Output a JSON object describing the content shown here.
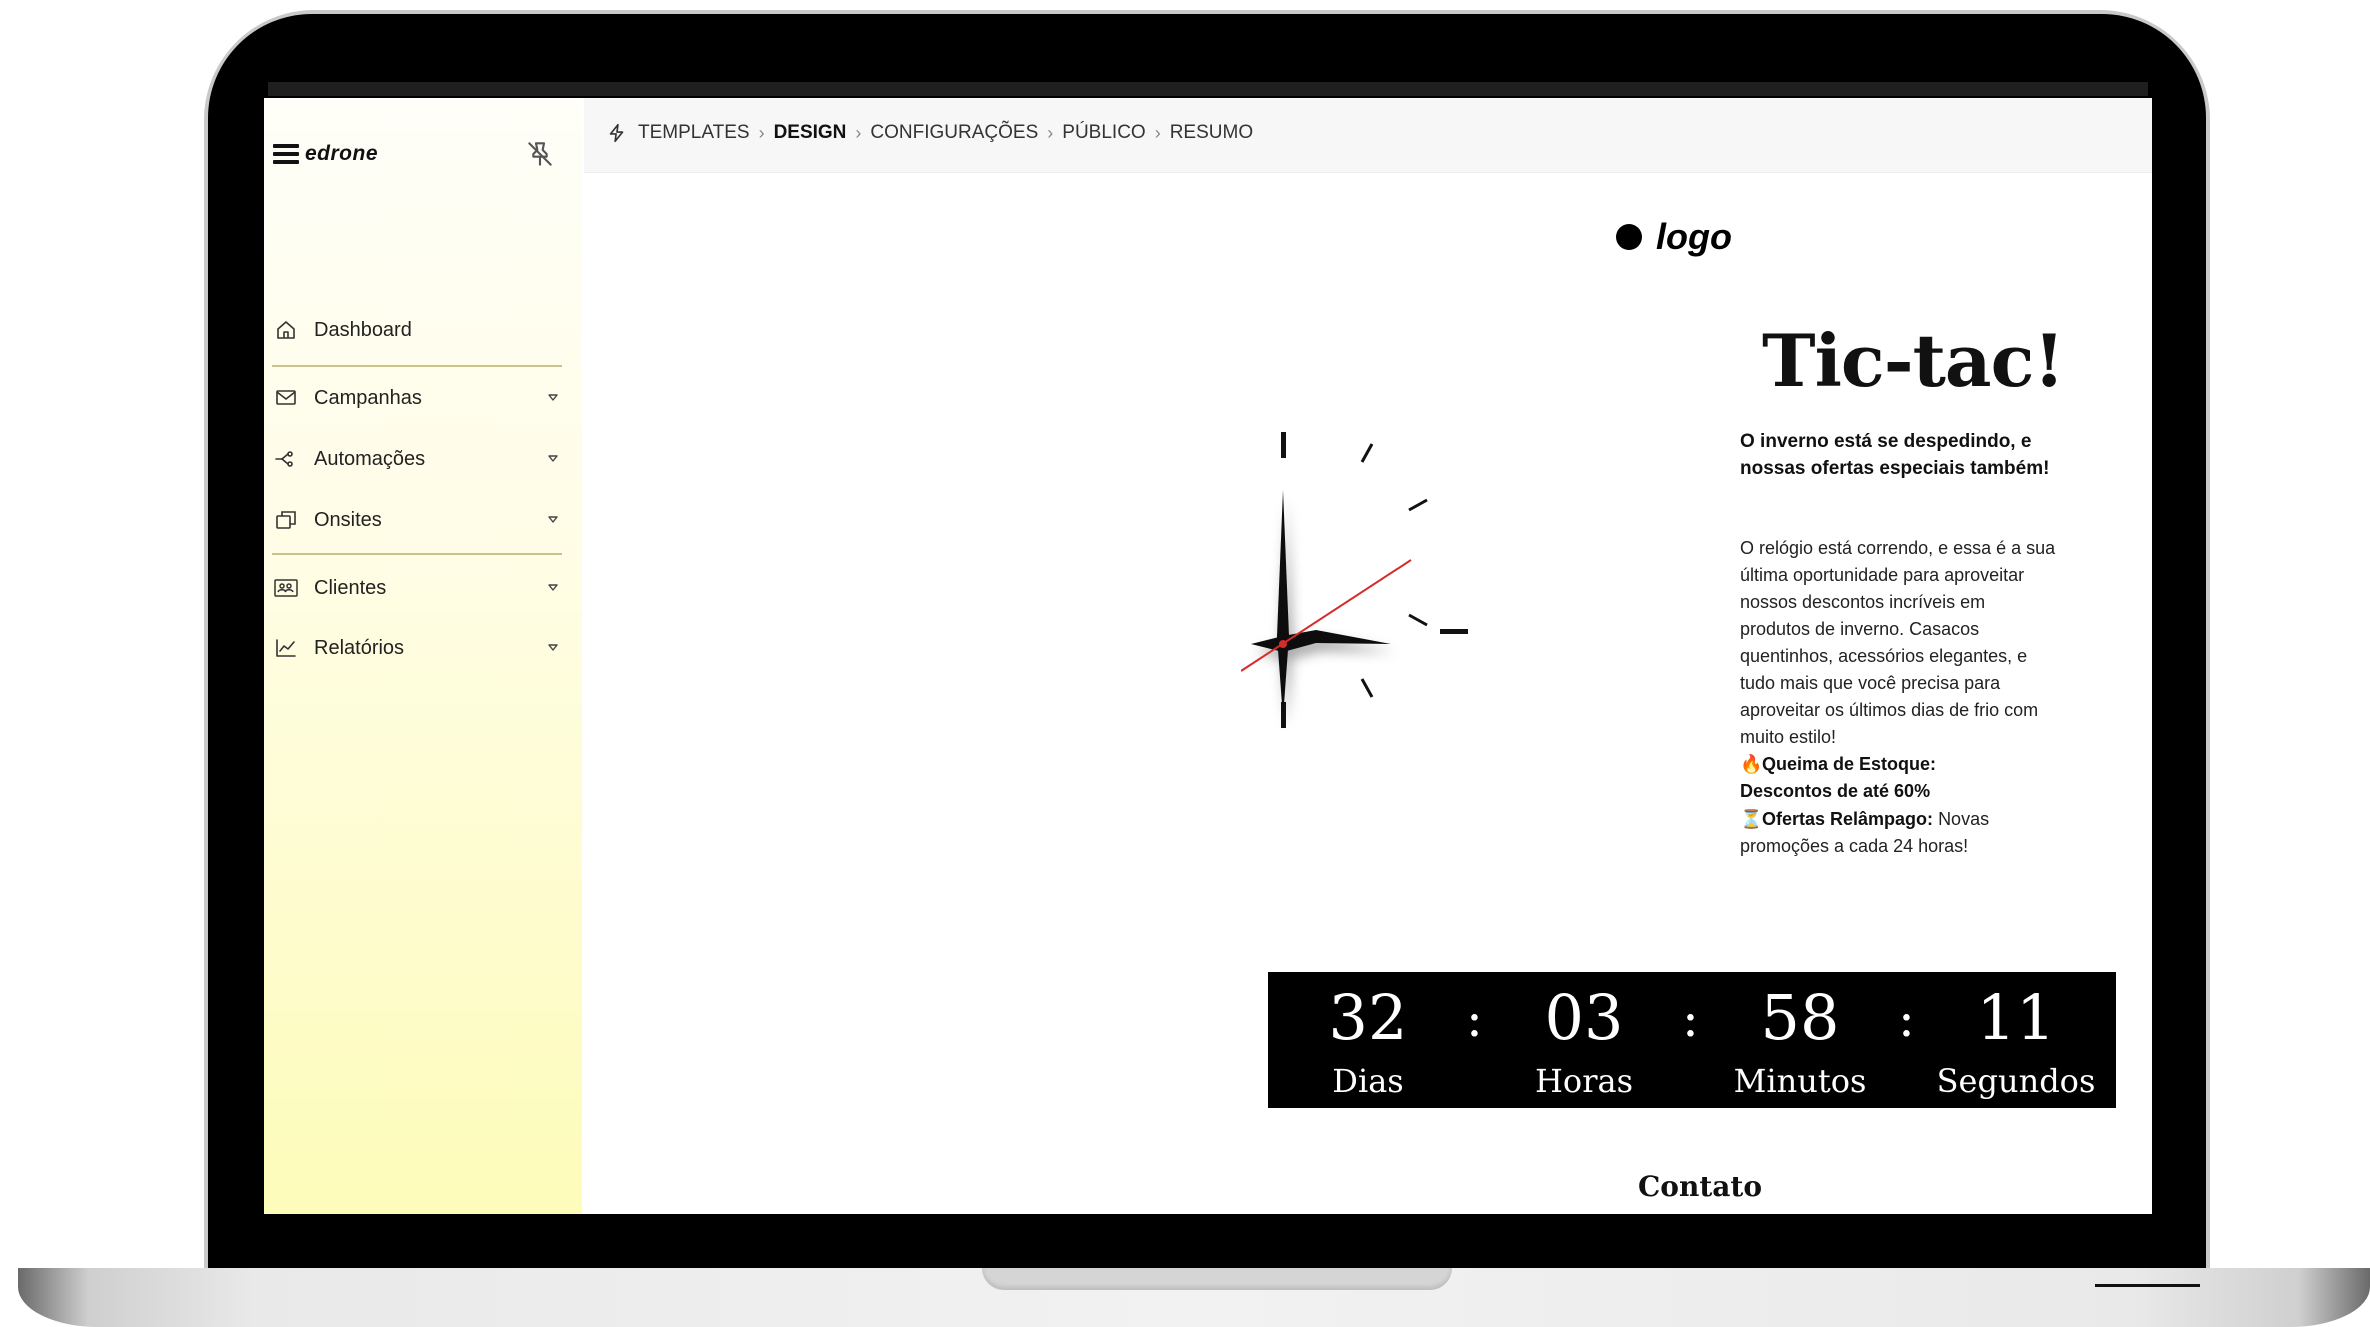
{
  "sidebar": {
    "brand": "edrone",
    "items": [
      {
        "label": "Dashboard",
        "icon": "home-icon"
      },
      {
        "label": "Campanhas",
        "icon": "mail-icon"
      },
      {
        "label": "Automações",
        "icon": "automation-icon"
      },
      {
        "label": "Onsites",
        "icon": "window-icon"
      },
      {
        "label": "Clientes",
        "icon": "contacts-icon"
      },
      {
        "label": "Relatórios",
        "icon": "chart-icon"
      }
    ]
  },
  "breadcrumb": {
    "items": [
      "TEMPLATES",
      "DESIGN",
      "CONFIGURAÇÕES",
      "PÚBLICO",
      "RESUMO"
    ],
    "active_index": 1
  },
  "template": {
    "logo_text": "logo",
    "headline": "Tic-tac!",
    "lead": "O inverno está se despedindo, e nossas ofertas especiais também!",
    "body": "O relógio está correndo, e essa é a sua última oportunidade para aproveitar nossos descontos incríveis em produtos de inverno. Casacos quentinhos, acessórios elegantes, e tudo mais que você precisa para aproveitar os últimos dias de frio com muito estilo!",
    "promo1_title": "Queima de Estoque:",
    "promo1_text": "Descontos de até 60%",
    "promo2_title": "Ofertas Relâmpago:",
    "promo2_text": "Novas promoções a cada 24 horas!",
    "countdown": [
      {
        "value": "32",
        "label": "Dias"
      },
      {
        "value": "03",
        "label": "Horas"
      },
      {
        "value": "58",
        "label": "Minutos"
      },
      {
        "value": "11",
        "label": "Segundos"
      }
    ],
    "countdown_separator": ":",
    "contact_heading": "Contato"
  },
  "colors": {
    "sidebar_top": "#fffef8",
    "sidebar_bottom": "#fdfcb9",
    "countdown_bg": "#000000",
    "clock_second_hand": "#d62b2b"
  }
}
